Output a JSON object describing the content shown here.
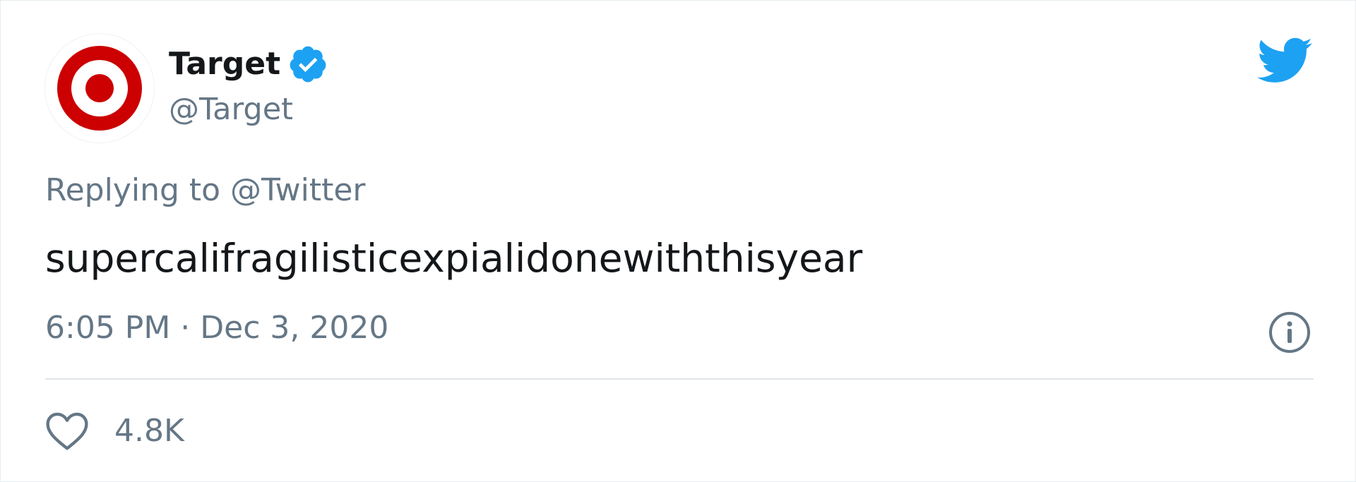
{
  "account": {
    "display_name": "Target",
    "handle": "@Target",
    "verified": true,
    "avatar_icon": "target-bullseye-logo",
    "brand_color": "#cc0000"
  },
  "platform": {
    "logo_icon": "twitter-bird-icon",
    "logo_color": "#1da1f2"
  },
  "tweet": {
    "replying_to": "Replying to @Twitter",
    "text": "supercalifragilisticexpialidonewiththisyear",
    "timestamp": "6:05 PM · Dec 3, 2020"
  },
  "actions": {
    "like_icon": "heart-outline-icon",
    "like_count": "4.8K",
    "info_icon": "info-circle-icon"
  },
  "colors": {
    "text_primary": "#14171a",
    "text_secondary": "#657786",
    "verified_badge": "#1da1f2",
    "divider": "#dfe5ea"
  }
}
